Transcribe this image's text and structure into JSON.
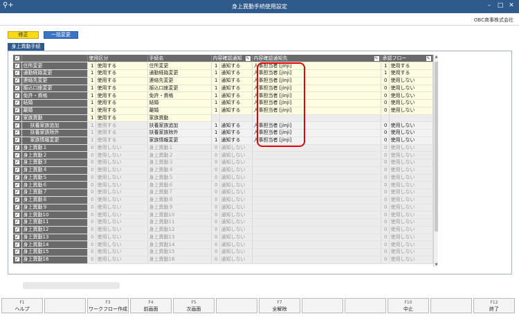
{
  "window": {
    "title": "身上異動手続使用設定",
    "company": "OBC商事株式会社"
  },
  "toolbar": {
    "modify_label": "修正",
    "bulk_label": "一括変更"
  },
  "tab_label": "身上異動手続",
  "columns": {
    "usage": "使用区分",
    "procedure": "手続名",
    "confirm_notice": "内容確認通知",
    "notice_to": "内容確認通知先",
    "approval": "承認フロー"
  },
  "rows": [
    {
      "name": "住所変更",
      "sub": false,
      "code": "1",
      "usage": "使用する",
      "proc": "住所変更",
      "ncode": "1",
      "notice": "通知する",
      "to": "人事担当者 [jinji]",
      "acode": "1",
      "approval": "使用する",
      "state": "y"
    },
    {
      "name": "通勤経路変更",
      "sub": false,
      "code": "1",
      "usage": "使用する",
      "proc": "通勤経路変更",
      "ncode": "1",
      "notice": "通知する",
      "to": "人事担当者 [jinji]",
      "acode": "1",
      "approval": "使用する",
      "state": "y"
    },
    {
      "name": "連絡先変更",
      "sub": false,
      "code": "1",
      "usage": "使用する",
      "proc": "連絡先変更",
      "ncode": "1",
      "notice": "通知する",
      "to": "人事担当者 [jinji]",
      "acode": "0",
      "approval": "使用しない",
      "state": "y"
    },
    {
      "name": "振込口座変更",
      "sub": false,
      "code": "1",
      "usage": "使用する",
      "proc": "振込口座変更",
      "ncode": "1",
      "notice": "通知する",
      "to": "人事担当者 [jinji]",
      "acode": "0",
      "approval": "使用しない",
      "state": "y"
    },
    {
      "name": "免許・資格",
      "sub": false,
      "code": "1",
      "usage": "使用する",
      "proc": "免許・資格",
      "ncode": "1",
      "notice": "通知する",
      "to": "人事担当者 [jinji]",
      "acode": "0",
      "approval": "使用しない",
      "state": "y"
    },
    {
      "name": "結婚",
      "sub": false,
      "code": "1",
      "usage": "使用する",
      "proc": "結婚",
      "ncode": "1",
      "notice": "通知する",
      "to": "人事担当者 [jinji]",
      "acode": "0",
      "approval": "使用しない",
      "state": "y"
    },
    {
      "name": "離婚",
      "sub": false,
      "code": "1",
      "usage": "使用する",
      "proc": "離婚",
      "ncode": "1",
      "notice": "通知する",
      "to": "人事担当者 [jinji]",
      "acode": "0",
      "approval": "使用しない",
      "state": "y"
    },
    {
      "name": "家族異動",
      "sub": false,
      "code": "1",
      "usage": "使用する",
      "proc": "家族異動",
      "ncode": "",
      "notice": "",
      "to": "",
      "acode": "",
      "approval": "",
      "state": "g"
    },
    {
      "name": "扶養家族追加",
      "sub": true,
      "code": "1",
      "usage": "使用する",
      "proc": "扶養家族追加",
      "ncode": "1",
      "notice": "通知する",
      "to": "人事担当者 [jinji]",
      "acode": "0",
      "approval": "使用しない",
      "state": "s"
    },
    {
      "name": "扶養家族除外",
      "sub": true,
      "code": "1",
      "usage": "使用する",
      "proc": "扶養家族除外",
      "ncode": "1",
      "notice": "通知する",
      "to": "人事担当者 [jinji]",
      "acode": "0",
      "approval": "使用しない",
      "state": "s"
    },
    {
      "name": "家族情報変更",
      "sub": true,
      "code": "1",
      "usage": "使用する",
      "proc": "家族情報変更",
      "ncode": "1",
      "notice": "通知する",
      "to": "人事担当者 [jinji]",
      "acode": "0",
      "approval": "使用しない",
      "state": "s"
    },
    {
      "name": "身上異動１",
      "sub": false,
      "code": "0",
      "usage": "使用しない",
      "proc": "身上異動１",
      "ncode": "0",
      "notice": "通知しない",
      "to": "",
      "acode": "0",
      "approval": "使用しない",
      "state": "n"
    },
    {
      "name": "身上異動２",
      "sub": false,
      "code": "0",
      "usage": "使用しない",
      "proc": "身上異動２",
      "ncode": "0",
      "notice": "通知しない",
      "to": "",
      "acode": "0",
      "approval": "使用しない",
      "state": "n"
    },
    {
      "name": "身上異動３",
      "sub": false,
      "code": "0",
      "usage": "使用しない",
      "proc": "身上異動３",
      "ncode": "0",
      "notice": "通知しない",
      "to": "",
      "acode": "0",
      "approval": "使用しない",
      "state": "n"
    },
    {
      "name": "身上異動４",
      "sub": false,
      "code": "0",
      "usage": "使用しない",
      "proc": "身上異動４",
      "ncode": "0",
      "notice": "通知しない",
      "to": "",
      "acode": "0",
      "approval": "使用しない",
      "state": "n"
    },
    {
      "name": "身上異動５",
      "sub": false,
      "code": "0",
      "usage": "使用しない",
      "proc": "身上異動５",
      "ncode": "0",
      "notice": "通知しない",
      "to": "",
      "acode": "0",
      "approval": "使用しない",
      "state": "n"
    },
    {
      "name": "身上異動６",
      "sub": false,
      "code": "0",
      "usage": "使用しない",
      "proc": "身上異動６",
      "ncode": "0",
      "notice": "通知しない",
      "to": "",
      "acode": "0",
      "approval": "使用しない",
      "state": "n"
    },
    {
      "name": "身上異動７",
      "sub": false,
      "code": "0",
      "usage": "使用しない",
      "proc": "身上異動７",
      "ncode": "0",
      "notice": "通知しない",
      "to": "",
      "acode": "0",
      "approval": "使用しない",
      "state": "n"
    },
    {
      "name": "身上異動８",
      "sub": false,
      "code": "0",
      "usage": "使用しない",
      "proc": "身上異動８",
      "ncode": "0",
      "notice": "通知しない",
      "to": "",
      "acode": "0",
      "approval": "使用しない",
      "state": "n"
    },
    {
      "name": "身上異動９",
      "sub": false,
      "code": "0",
      "usage": "使用しない",
      "proc": "身上異動９",
      "ncode": "0",
      "notice": "通知しない",
      "to": "",
      "acode": "0",
      "approval": "使用しない",
      "state": "n"
    },
    {
      "name": "身上異動10",
      "sub": false,
      "code": "0",
      "usage": "使用しない",
      "proc": "身上異動10",
      "ncode": "0",
      "notice": "通知しない",
      "to": "",
      "acode": "0",
      "approval": "使用しない",
      "state": "n"
    },
    {
      "name": "身上異動11",
      "sub": false,
      "code": "0",
      "usage": "使用しない",
      "proc": "身上異動11",
      "ncode": "0",
      "notice": "通知しない",
      "to": "",
      "acode": "0",
      "approval": "使用しない",
      "state": "n"
    },
    {
      "name": "身上異動12",
      "sub": false,
      "code": "0",
      "usage": "使用しない",
      "proc": "身上異動12",
      "ncode": "0",
      "notice": "通知しない",
      "to": "",
      "acode": "0",
      "approval": "使用しない",
      "state": "n"
    },
    {
      "name": "身上異動13",
      "sub": false,
      "code": "0",
      "usage": "使用しない",
      "proc": "身上異動13",
      "ncode": "0",
      "notice": "通知しない",
      "to": "",
      "acode": "0",
      "approval": "使用しない",
      "state": "n"
    },
    {
      "name": "身上異動14",
      "sub": false,
      "code": "0",
      "usage": "使用しない",
      "proc": "身上異動14",
      "ncode": "0",
      "notice": "通知しない",
      "to": "",
      "acode": "0",
      "approval": "使用しない",
      "state": "n"
    },
    {
      "name": "身上異動15",
      "sub": false,
      "code": "0",
      "usage": "使用しない",
      "proc": "身上異動15",
      "ncode": "0",
      "notice": "通知しない",
      "to": "",
      "acode": "0",
      "approval": "使用しない",
      "state": "n"
    },
    {
      "name": "身上異動16",
      "sub": false,
      "code": "0",
      "usage": "使用しない",
      "proc": "身上異動16",
      "ncode": "0",
      "notice": "通知しない",
      "to": "",
      "acode": "0",
      "approval": "使用しない",
      "state": "n"
    }
  ],
  "fkeys": [
    {
      "key": "F1",
      "label": "ヘルプ"
    },
    {
      "key": "",
      "label": ""
    },
    {
      "key": "F3",
      "label": "ワークフロー作成"
    },
    {
      "key": "F4",
      "label": "前画面"
    },
    {
      "key": "F5",
      "label": "次画面"
    },
    {
      "key": "",
      "label": ""
    },
    {
      "key": "F7",
      "label": "全解除"
    },
    {
      "key": "",
      "label": ""
    },
    {
      "key": "",
      "label": ""
    },
    {
      "key": "F10",
      "label": "中止"
    },
    {
      "key": "",
      "label": ""
    },
    {
      "key": "F12",
      "label": "終了"
    }
  ]
}
